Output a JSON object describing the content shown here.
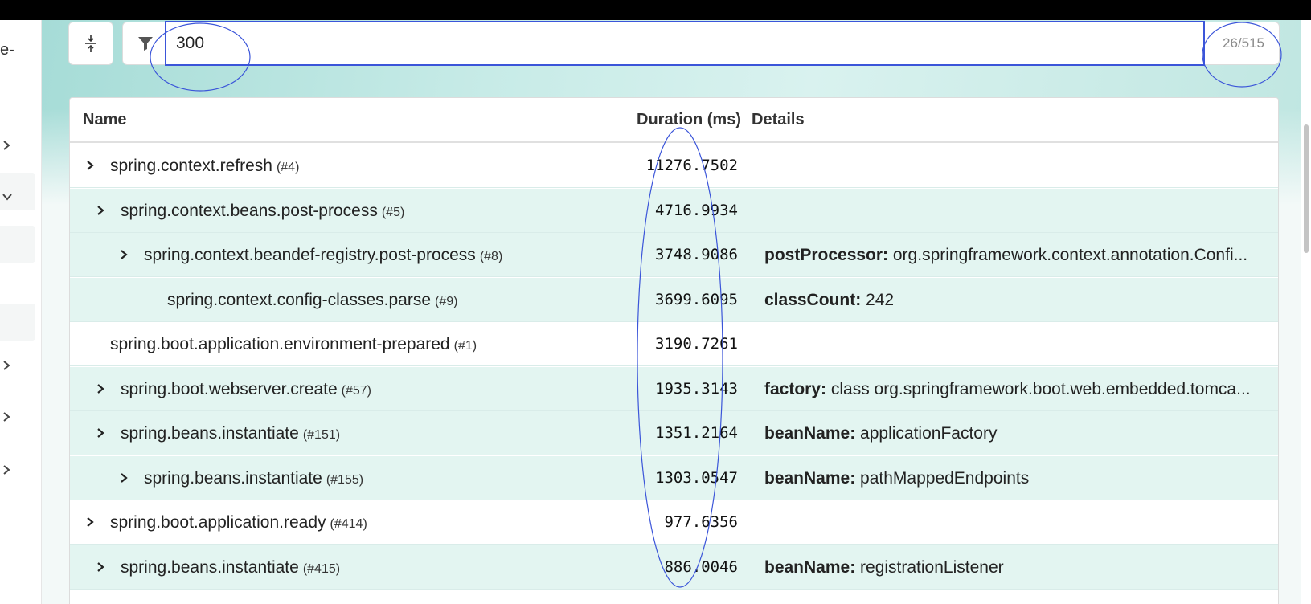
{
  "sidebar": {
    "partial_text": "e-",
    "chevrons": [
      "chevron-right",
      "chevron-down",
      "chevron-right",
      "chevron-right",
      "chevron-right"
    ]
  },
  "toolbar": {
    "filter_value": "300",
    "filter_count": "26/515"
  },
  "table": {
    "headers": {
      "name": "Name",
      "duration": "Duration (ms)",
      "details": "Details"
    },
    "rows": [
      {
        "name": "spring.context.refresh",
        "id": "(#4)",
        "duration": "11276.7502",
        "detail_key": "",
        "detail_val": "",
        "level": 0,
        "expandable": true,
        "shade": "white"
      },
      {
        "name": "spring.context.beans.post-process",
        "id": "(#5)",
        "duration": "4716.9934",
        "detail_key": "",
        "detail_val": "",
        "level": 1,
        "expandable": true,
        "shade": "teal"
      },
      {
        "name": "spring.context.beandef-registry.post-process",
        "id": "(#8)",
        "duration": "3748.9086",
        "detail_key": "postProcessor:",
        "detail_val": "org.springframework.context.annotation.Confi...",
        "level": 2,
        "expandable": true,
        "shade": "teal"
      },
      {
        "name": "spring.context.config-classes.parse",
        "id": "(#9)",
        "duration": "3699.6095",
        "detail_key": "classCount:",
        "detail_val": "242",
        "level": 3,
        "expandable": false,
        "shade": "teal"
      },
      {
        "name": "spring.boot.application.environment-prepared",
        "id": "(#1)",
        "duration": "3190.7261",
        "detail_key": "",
        "detail_val": "",
        "level": 0,
        "expandable": false,
        "shade": "white"
      },
      {
        "name": "spring.boot.webserver.create",
        "id": "(#57)",
        "duration": "1935.3143",
        "detail_key": "factory:",
        "detail_val": "class org.springframework.boot.web.embedded.tomca...",
        "level": 1,
        "expandable": true,
        "shade": "teal"
      },
      {
        "name": "spring.beans.instantiate",
        "id": "(#151)",
        "duration": "1351.2164",
        "detail_key": "beanName:",
        "detail_val": "applicationFactory",
        "level": 1,
        "expandable": true,
        "shade": "teal"
      },
      {
        "name": "spring.beans.instantiate",
        "id": "(#155)",
        "duration": "1303.0547",
        "detail_key": "beanName:",
        "detail_val": "pathMappedEndpoints",
        "level": 2,
        "expandable": true,
        "shade": "teal"
      },
      {
        "name": "spring.boot.application.ready",
        "id": "(#414)",
        "duration": "977.6356",
        "detail_key": "",
        "detail_val": "",
        "level": 0,
        "expandable": true,
        "shade": "white"
      },
      {
        "name": "spring.beans.instantiate",
        "id": "(#415)",
        "duration": "886.0046",
        "detail_key": "beanName:",
        "detail_val": "registrationListener",
        "level": 1,
        "expandable": true,
        "shade": "teal"
      }
    ]
  },
  "colors": {
    "row_teal": "#e3f5f1",
    "annotation_blue": "#3b55d9"
  }
}
